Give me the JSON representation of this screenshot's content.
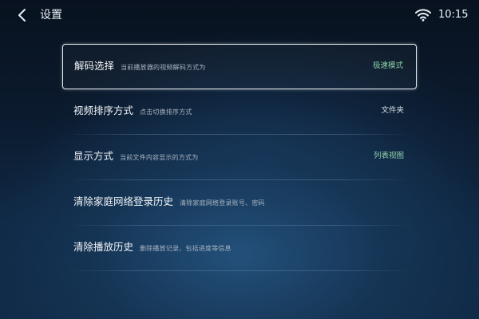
{
  "header": {
    "title": "设置",
    "time": "10:15"
  },
  "icons": {
    "back": "chevron-left-icon",
    "wifi": "wifi-icon"
  },
  "colors": {
    "value_green": "#8fd3a8",
    "value_white": "#d9e1ea",
    "selection_border": "#e8eef5"
  },
  "settings": {
    "items": [
      {
        "title": "解码选择",
        "description": "当前播放器的视频解码方式为",
        "value": "极速模式",
        "value_color": "#8fd3a8",
        "selected": true
      },
      {
        "title": "视频排序方式",
        "description": "点击切换排序方式",
        "value": "文件夹",
        "value_color": "#d9e1ea",
        "selected": false
      },
      {
        "title": "显示方式",
        "description": "当前文件内容显示的方式为",
        "value": "列表视图",
        "value_color": "#8fd3a8",
        "selected": false
      },
      {
        "title": "清除家庭网络登录历史",
        "description": "清除家庭网络登录账号、密码",
        "value": "",
        "value_color": "#d9e1ea",
        "selected": false
      },
      {
        "title": "清除播放历史",
        "description": "删除播放记录、包括进度等信息",
        "value": "",
        "value_color": "#d9e1ea",
        "selected": false
      }
    ]
  }
}
